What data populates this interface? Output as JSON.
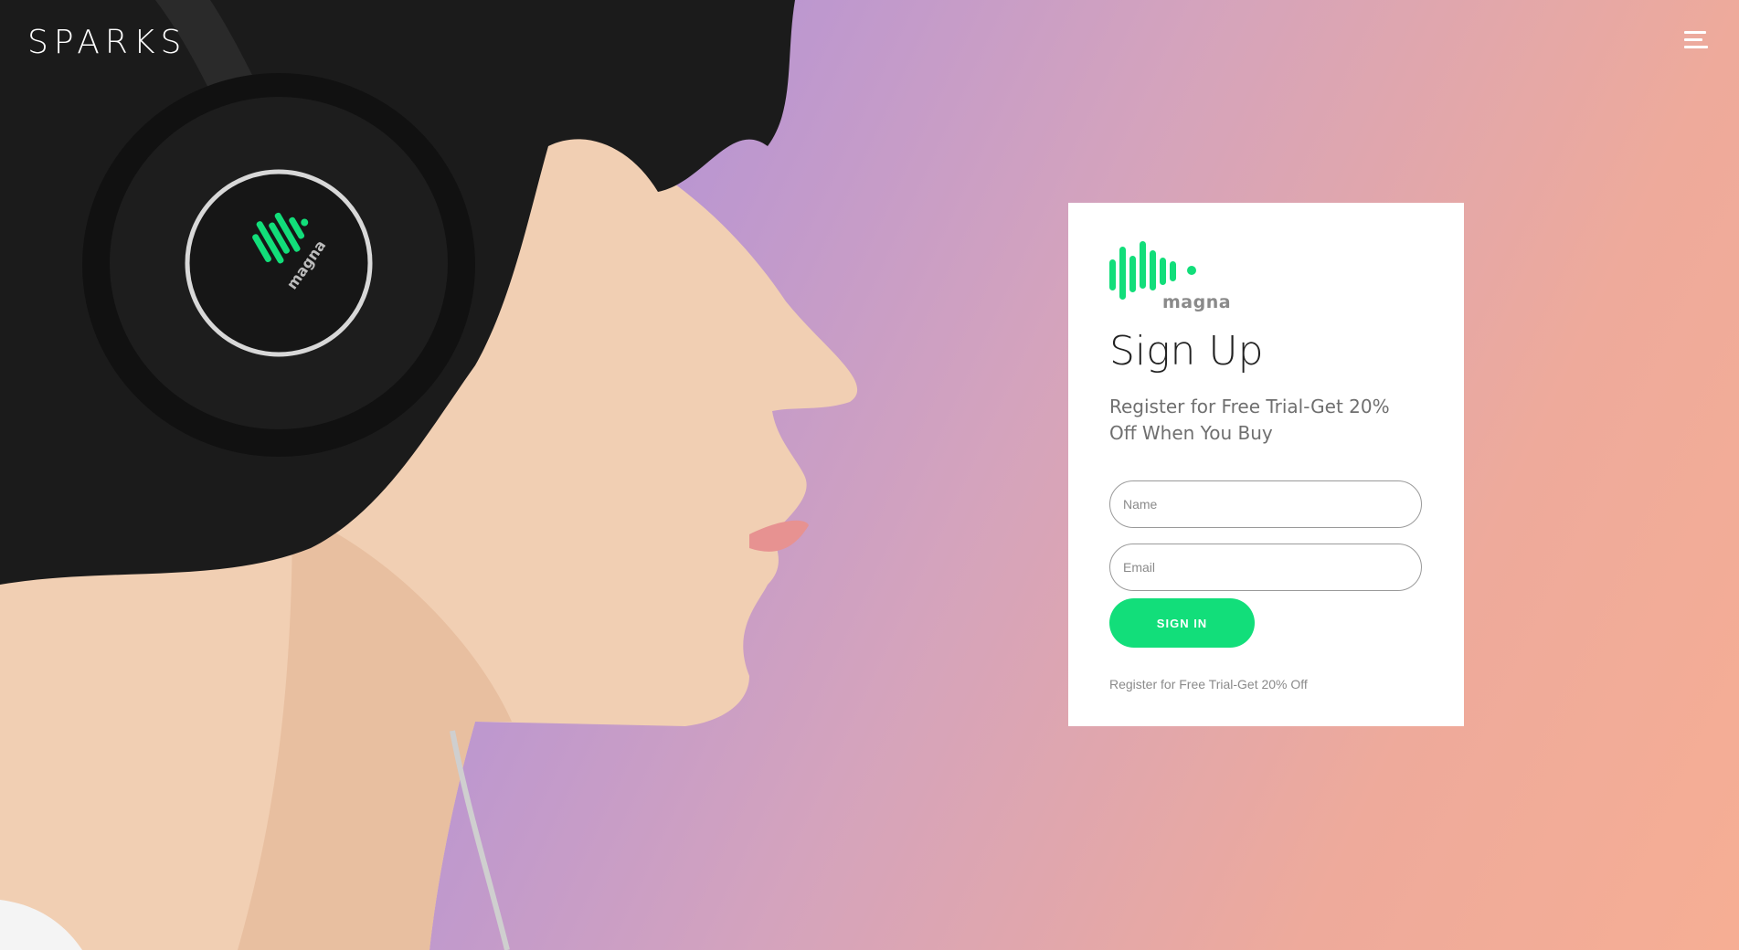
{
  "header": {
    "brand": "SPARKS",
    "menu_icon": "hamburger-menu-icon"
  },
  "hero": {
    "headphone_logo_text": "magna"
  },
  "signup": {
    "logo_text": "magna",
    "title": "Sign Up",
    "subtitle": "Register for Free Trial-Get 20% Off When You Buy",
    "name_placeholder": "Name",
    "email_placeholder": "Email",
    "submit_label": "SIGN IN",
    "note": "Register for Free Trial-Get 20% Off"
  },
  "colors": {
    "accent": "#12de7a",
    "card_bg": "#ffffff",
    "gradient_start": "#8f7ee0",
    "gradient_end": "#f6ae94"
  }
}
